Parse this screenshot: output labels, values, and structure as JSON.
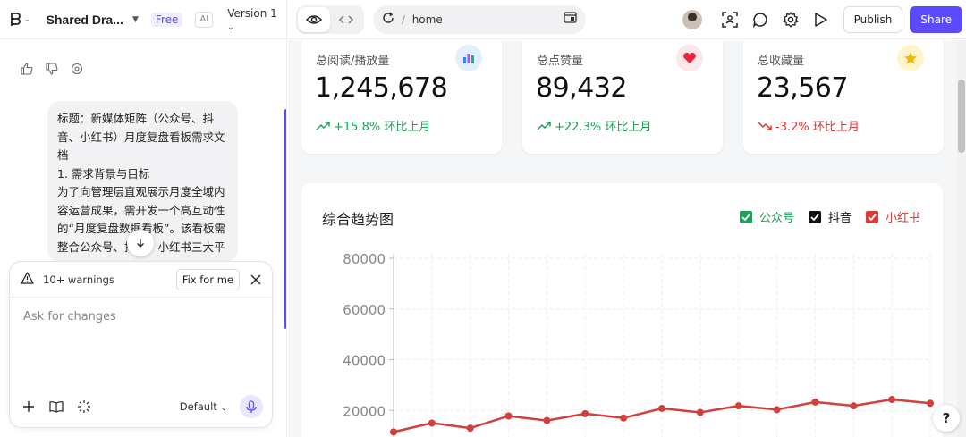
{
  "topbar": {
    "project_name": "Shared Dra...",
    "plan_badge": "Free",
    "ai_badge": "AI",
    "version": "Version 1",
    "url_sep": "/",
    "url_path": "home",
    "publish_label": "Publish",
    "share_label": "Share",
    "accent_color": "#5a4bff"
  },
  "chat": {
    "message": "标题：新媒体矩阵（公众号、抖音、小红书）月度复盘看板需求文档\n1. 需求背景与目标\n为了向管理层直观展示月度全域内容运营成果，需开发一个高互动性的“月度复盘数据看板”。该看板需整合公众号、抖音、小红书三大平",
    "warnings_label": "10+ warnings",
    "fix_label": "Fix for me",
    "input_placeholder": "Ask for changes",
    "model_label": "Default"
  },
  "stats": [
    {
      "label": "总阅读/播放量",
      "value": "1,245,678",
      "change": "+15.8% 环比上月",
      "trend": "up",
      "icon": "bar-chart-icon",
      "icon_bg": "#e3efff"
    },
    {
      "label": "总点赞量",
      "value": "89,432",
      "change": "+22.3% 环比上月",
      "trend": "up",
      "icon": "heart-icon",
      "icon_bg": "#ffe6ea"
    },
    {
      "label": "总收藏量",
      "value": "23,567",
      "change": "-3.2% 环比上月",
      "trend": "down",
      "icon": "star-icon",
      "icon_bg": "#fff5cc"
    }
  ],
  "chart": {
    "title": "综合趋势图",
    "legend": [
      {
        "name": "公众号",
        "color": "#1ea15a",
        "checked": true
      },
      {
        "name": "抖音",
        "color": "#111111",
        "checked": true
      },
      {
        "name": "小红书",
        "color": "#d93a3a",
        "checked": true
      }
    ]
  },
  "chart_data": {
    "type": "line",
    "title": "综合趋势图",
    "yticks": [
      "80000",
      "60000",
      "40000",
      "20000"
    ],
    "ylim": [
      0,
      80000
    ],
    "grid": true,
    "legend_position": "top-right",
    "series": [
      {
        "name": "小红书",
        "color": "#d0413e",
        "values": [
          11500,
          15000,
          13000,
          17800,
          16000,
          18700,
          17000,
          20800,
          19200,
          21800,
          20300,
          23300,
          21800,
          24300,
          22800
        ]
      }
    ]
  },
  "help_label": "?"
}
